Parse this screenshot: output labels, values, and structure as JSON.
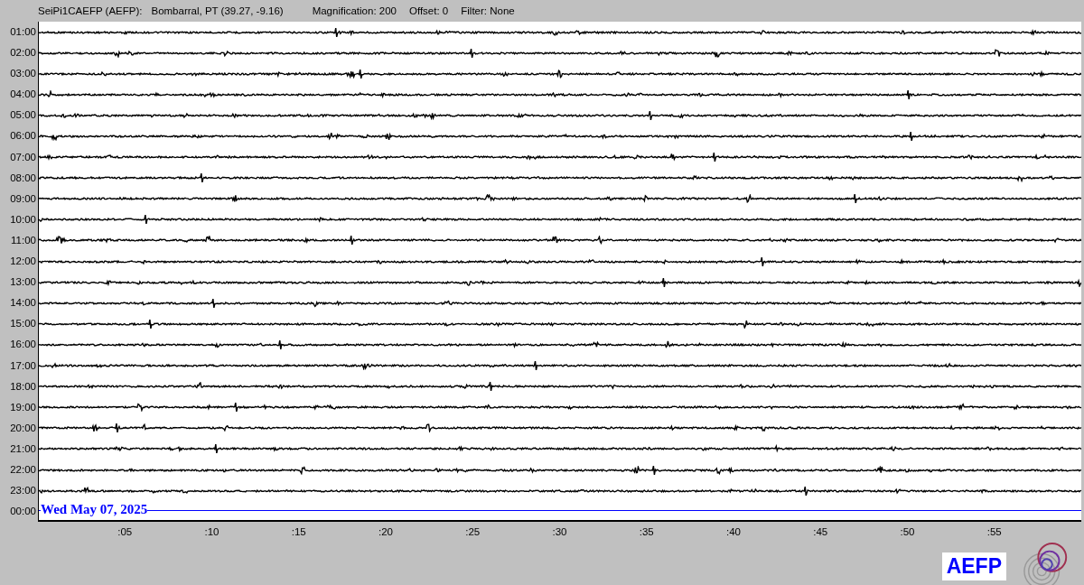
{
  "header": {
    "station": "SeiPi1CAEFP (AEFP):",
    "location": "Bombarral, PT (39.27, -9.16)",
    "magnification": "Magnification: 200",
    "offset": "Offset: 0",
    "filter": "Filter: None"
  },
  "rows": [
    {
      "label": "01:00",
      "kind": "trace"
    },
    {
      "label": "02:00",
      "kind": "trace"
    },
    {
      "label": "03:00",
      "kind": "trace"
    },
    {
      "label": "04:00",
      "kind": "trace"
    },
    {
      "label": "05:00",
      "kind": "trace"
    },
    {
      "label": "06:00",
      "kind": "trace"
    },
    {
      "label": "07:00",
      "kind": "trace"
    },
    {
      "label": "08:00",
      "kind": "trace"
    },
    {
      "label": "09:00",
      "kind": "trace"
    },
    {
      "label": "10:00",
      "kind": "trace"
    },
    {
      "label": "11:00",
      "kind": "trace"
    },
    {
      "label": "12:00",
      "kind": "trace"
    },
    {
      "label": "13:00",
      "kind": "trace"
    },
    {
      "label": "14:00",
      "kind": "trace"
    },
    {
      "label": "15:00",
      "kind": "trace"
    },
    {
      "label": "16:00",
      "kind": "trace"
    },
    {
      "label": "17:00",
      "kind": "trace"
    },
    {
      "label": "18:00",
      "kind": "trace"
    },
    {
      "label": "19:00",
      "kind": "trace"
    },
    {
      "label": "20:00",
      "kind": "trace"
    },
    {
      "label": "21:00",
      "kind": "trace"
    },
    {
      "label": "22:00",
      "kind": "trace"
    },
    {
      "label": "23:00",
      "kind": "trace"
    },
    {
      "label": "00:00",
      "kind": "pending"
    }
  ],
  "date": "Wed May 07, 2025",
  "xticks": [
    ":05",
    ":10",
    ":15",
    ":20",
    ":25",
    ":30",
    ":35",
    ":40",
    ":45",
    ":50",
    ":55"
  ],
  "logo_text": "AEFP"
}
